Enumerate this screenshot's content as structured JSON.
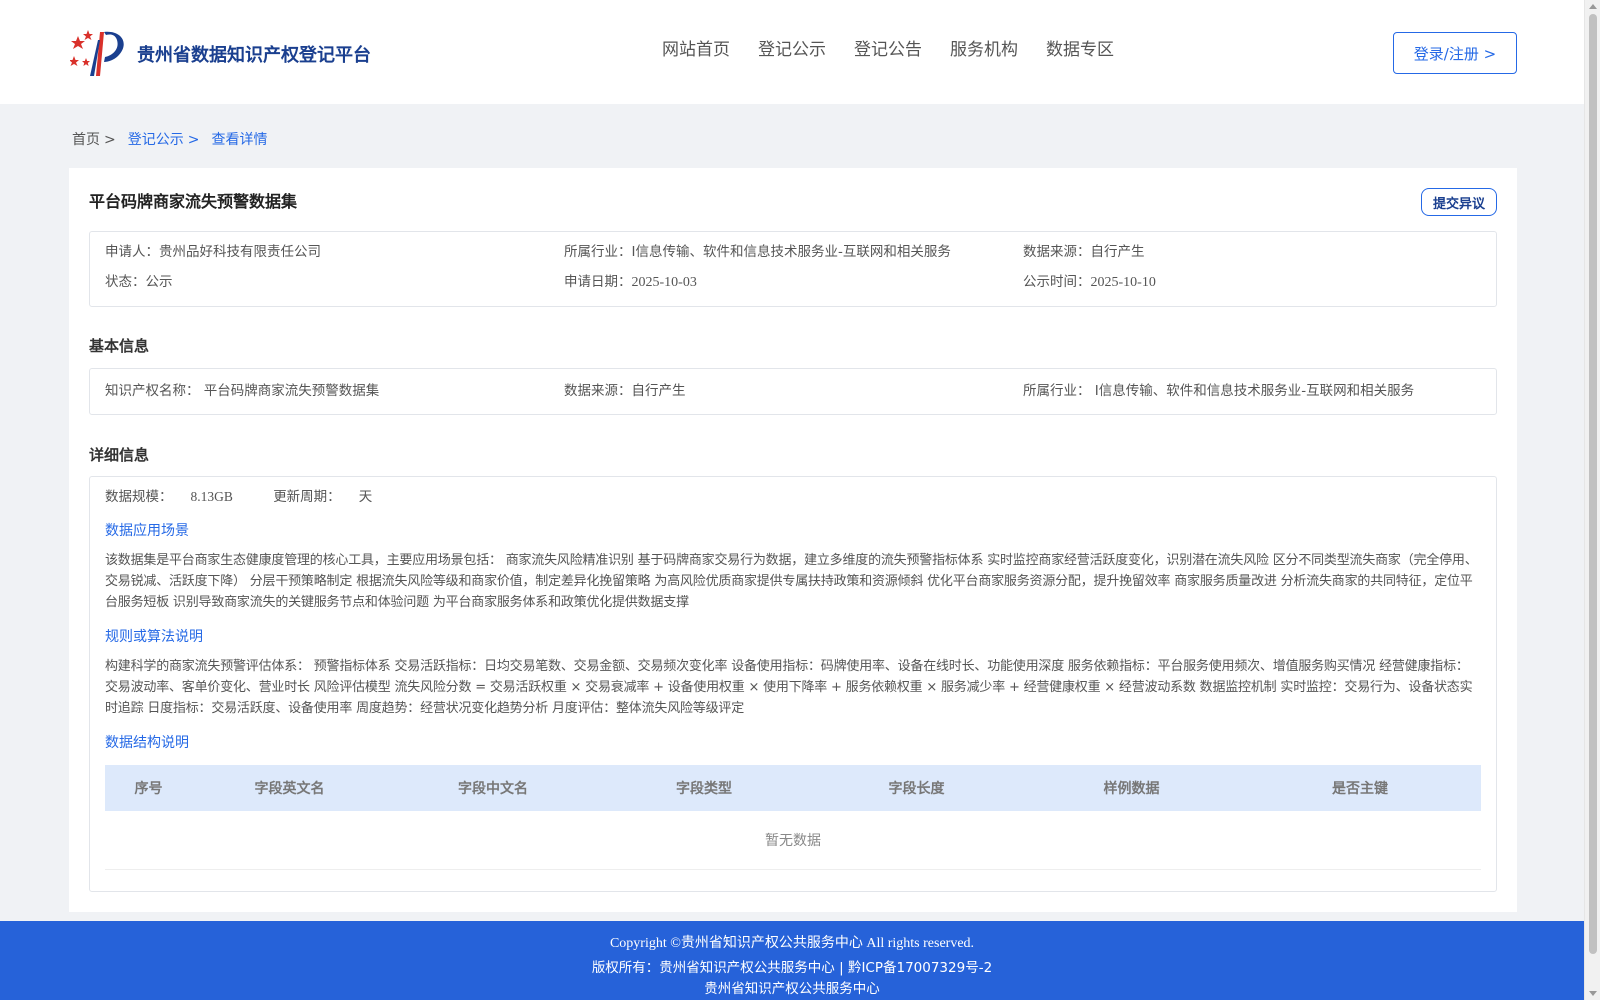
{
  "header": {
    "site_title": "贵州省数据知识产权登记平台",
    "nav": [
      "网站首页",
      "登记公示",
      "登记公告",
      "服务机构",
      "数据专区"
    ],
    "login_label": "登录/注册 >"
  },
  "breadcrumb": {
    "home": "首页",
    "section": "登记公示",
    "current": "查看详情",
    "separator": ">"
  },
  "record": {
    "title": "平台码牌商家流失预警数据集",
    "objection_label": "提交异议",
    "applicant_label": "申请人：",
    "applicant": "贵州品好科技有限责任公司",
    "industry_label": "所属行业：",
    "industry": "I信息传输、软件和信息技术服务业-互联网和相关服务",
    "source_label": "数据来源：",
    "source": "自行产生",
    "status_label": "状态：",
    "status": "公示",
    "apply_date_label": "申请日期：",
    "apply_date": "2025-10-03",
    "publish_date_label": "公示时间：",
    "publish_date": "2025-10-10"
  },
  "basic": {
    "section_title": "基本信息",
    "ip_name_label": "知识产权名称：",
    "ip_name": "平台码牌商家流失预警数据集",
    "source_label": "数据来源：",
    "source": "自行产生",
    "industry_label": "所属行业：",
    "industry": "I信息传输、软件和信息技术服务业-互联网和相关服务"
  },
  "detail": {
    "section_title": "详细信息",
    "scale_label": "数据规模：",
    "scale": "8.13GB",
    "cycle_label": "更新周期：",
    "cycle": "天",
    "scenario_title": "数据应用场景",
    "scenario_text": "该数据集是平台商家生态健康度管理的核心工具，主要应用场景包括： 商家流失风险精准识别 基于码牌商家交易行为数据，建立多维度的流失预警指标体系 实时监控商家经营活跃度变化，识别潜在流失风险 区分不同类型流失商家（完全停用、交易锐减、活跃度下降） 分层干预策略制定 根据流失风险等级和商家价值，制定差异化挽留策略 为高风险优质商家提供专属扶持政策和资源倾斜 优化平台商家服务资源分配，提升挽留效率 商家服务质量改进 分析流失商家的共同特征，定位平台服务短板 识别导致商家流失的关键服务节点和体验问题 为平台商家服务体系和政策优化提供数据支撑",
    "rule_title": "规则或算法说明",
    "rule_text": "构建科学的商家流失预警评估体系： 预警指标体系 交易活跃指标：日均交易笔数、交易金额、交易频次变化率 设备使用指标：码牌使用率、设备在线时长、功能使用深度 服务依赖指标：平台服务使用频次、增值服务购买情况 经营健康指标：交易波动率、客单价变化、营业时长 风险评估模型 流失风险分数 = 交易活跃权重 × 交易衰减率 + 设备使用权重 × 使用下降率 + 服务依赖权重 × 服务减少率 + 经营健康权重 × 经营波动系数 数据监控机制 实时监控：交易行为、设备状态实时追踪 日度指标：交易活跃度、设备使用率 周度趋势：经营状况变化趋势分析 月度评估：整体流失风险等级评定",
    "structure_title": "数据结构说明",
    "table_headers": [
      "序号",
      "字段英文名",
      "字段中文名",
      "字段类型",
      "字段长度",
      "样例数据",
      "是否主键"
    ],
    "empty_text": "暂无数据"
  },
  "footer": {
    "copyright": "Copyright ©贵州省知识产权公共服务中心 All rights reserved.",
    "owner": "版权所有：贵州省知识产权公共服务中心 | 黔ICP备17007329号-2",
    "org": "贵州省知识产权公共服务中心"
  },
  "colors": {
    "accent": "#2569e6",
    "footer_bg": "#2662d9",
    "table_header_bg": "#dde9fb"
  }
}
